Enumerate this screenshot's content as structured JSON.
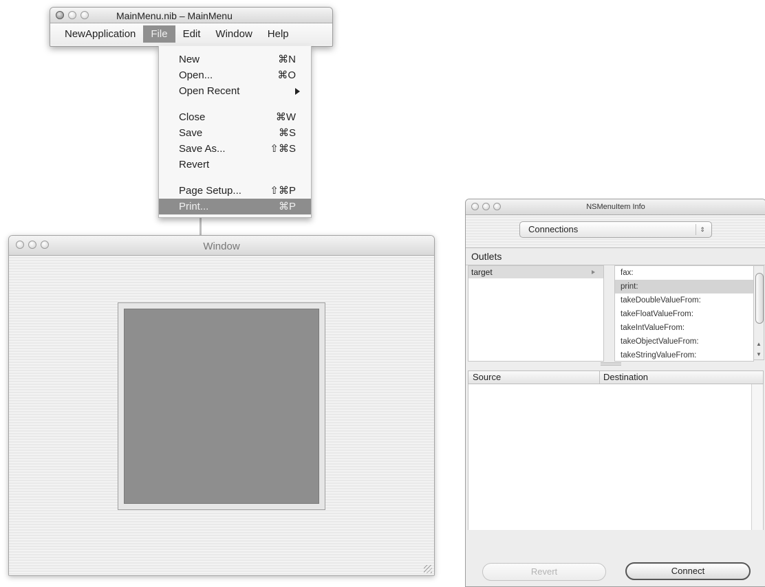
{
  "nib_window": {
    "title": "MainMenu.nib – MainMenu",
    "menubar": [
      "NewApplication",
      "File",
      "Edit",
      "Window",
      "Help"
    ],
    "active_menu": "File"
  },
  "file_menu": {
    "items": [
      {
        "label": "New",
        "shortcut": "⌘N"
      },
      {
        "label": "Open...",
        "shortcut": "⌘O"
      },
      {
        "label": "Open Recent",
        "shortcut": ""
      },
      {
        "label": "Close",
        "shortcut": "⌘W"
      },
      {
        "label": "Save",
        "shortcut": "⌘S"
      },
      {
        "label": "Save As...",
        "shortcut": "⇧⌘S"
      },
      {
        "label": "Revert",
        "shortcut": ""
      },
      {
        "label": "Page Setup...",
        "shortcut": "⇧⌘P"
      },
      {
        "label": "Print...",
        "shortcut": "⌘P"
      }
    ],
    "highlighted": "Print..."
  },
  "window": {
    "title": "Window"
  },
  "info_panel": {
    "title": "NSMenuItem Info",
    "popup_value": "Connections",
    "popup_stepper": "⇕",
    "outlets_header": "Outlets",
    "outlets": [
      "target"
    ],
    "actions": [
      "fax:",
      "print:",
      "takeDoubleValueFrom:",
      "takeFloatValueFrom:",
      "takeIntValueFrom:",
      "takeObjectValueFrom:",
      "takeStringValueFrom:"
    ],
    "selected_action": "print:",
    "scroll_up": "▲",
    "scroll_down": "▼",
    "columns": [
      "Source",
      "Destination"
    ],
    "buttons": {
      "revert": "Revert",
      "connect": "Connect"
    }
  }
}
